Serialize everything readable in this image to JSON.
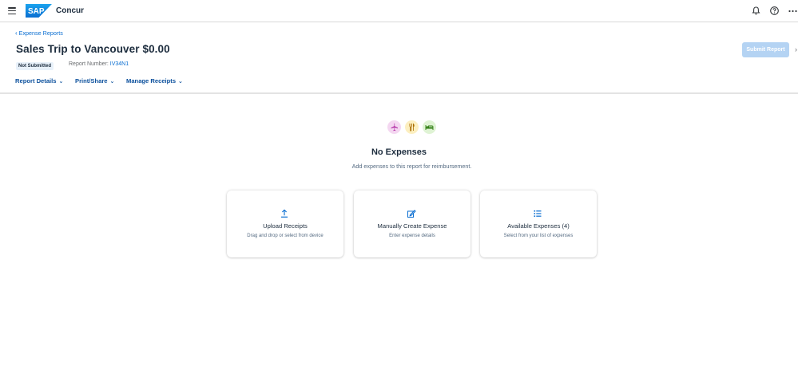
{
  "topbar": {
    "brand_logo_text": "SAP",
    "product_name": "Concur",
    "icons": [
      "menu-icon",
      "bell-icon",
      "help-icon",
      "more-icon"
    ]
  },
  "header": {
    "breadcrumb": "Expense Reports",
    "title": "Sales Trip to Vancouver $0.00",
    "status": "Not Submitted",
    "report_number_label": "Report Number:",
    "report_number": "IV34N1",
    "submit_label": "Submit Report"
  },
  "tabs": [
    {
      "label": "Report Details"
    },
    {
      "label": "Print/Share"
    },
    {
      "label": "Manage Receipts"
    }
  ],
  "empty_state": {
    "icons": [
      "airplane-icon",
      "restaurant-icon",
      "bed-icon"
    ],
    "title": "No Expenses",
    "subtitle": "Add expenses to this report for reimbursement."
  },
  "cards": [
    {
      "icon": "upload-icon",
      "title": "Upload Receipts",
      "subtitle": "Drag and drop or select from device"
    },
    {
      "icon": "edit-icon",
      "title": "Manually Create Expense",
      "subtitle": "Enter expense details"
    },
    {
      "icon": "list-icon",
      "title": "Available Expenses (4)",
      "subtitle": "Select from your list of expenses"
    }
  ],
  "colors": {
    "accent": "#0a6ed1",
    "submit_disabled": "#b4d3f3",
    "airplane_chip": "#f4d7f1",
    "restaurant_chip": "#fcefc0",
    "bed_chip": "#dff3d4"
  }
}
